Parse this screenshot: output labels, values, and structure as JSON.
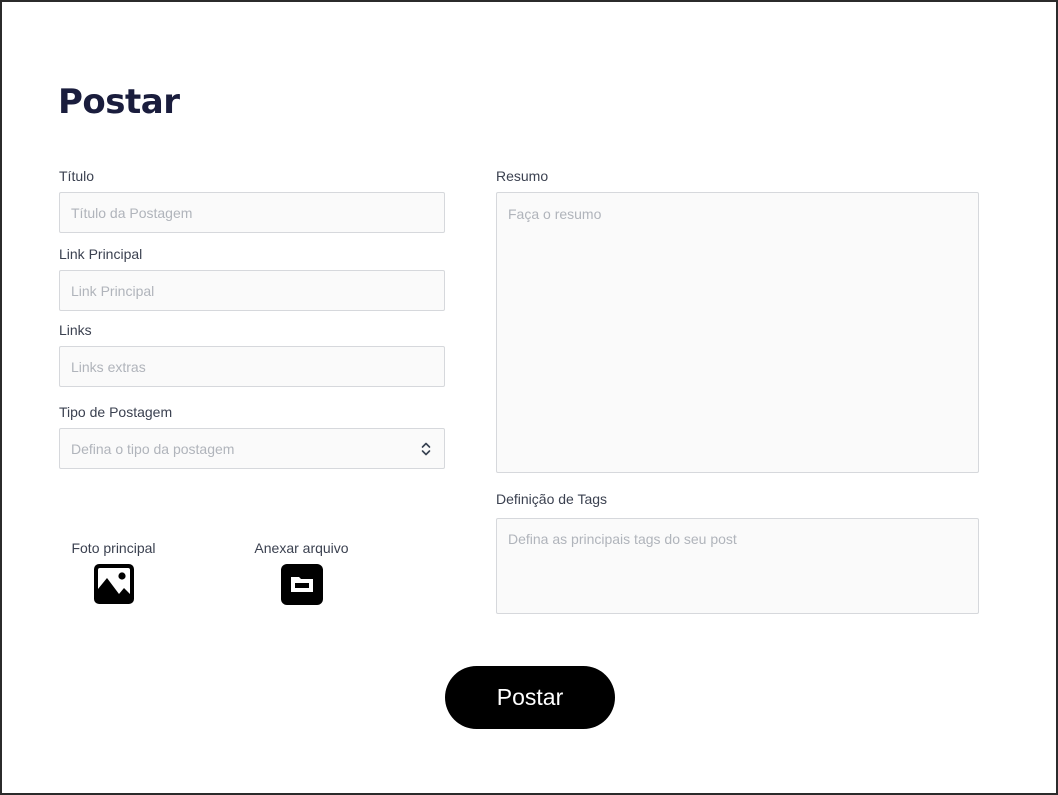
{
  "page": {
    "title": "Postar"
  },
  "form": {
    "titulo": {
      "label": "Título",
      "placeholder": "Título da Postagem"
    },
    "link_principal": {
      "label": "Link Principal",
      "placeholder": "Link Principal"
    },
    "links": {
      "label": "Links",
      "placeholder": "Links extras"
    },
    "tipo": {
      "label": "Tipo de Postagem",
      "placeholder": "Defina o tipo da postagem"
    },
    "resumo": {
      "label": "Resumo",
      "placeholder": "Faça o resumo"
    },
    "tags": {
      "label": "Definição de Tags",
      "placeholder": "Defina as principais tags do seu post"
    }
  },
  "attachments": {
    "foto": {
      "label": "Foto principal",
      "icon": "image-icon"
    },
    "arquivo": {
      "label": "Anexar arquivo",
      "icon": "folder-icon"
    }
  },
  "submit": {
    "label": "Postar"
  }
}
